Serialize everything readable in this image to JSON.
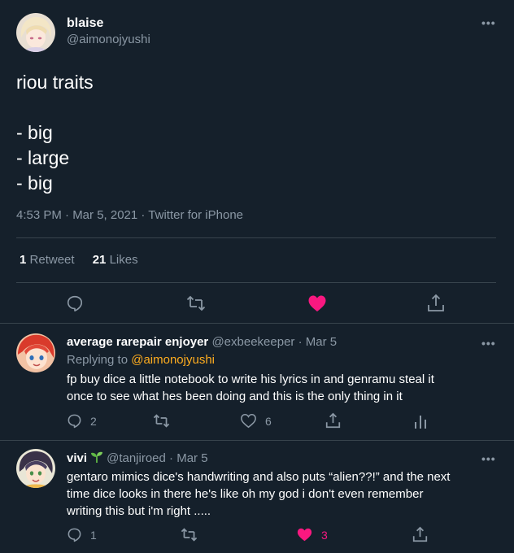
{
  "main_tweet": {
    "display_name": "blaise",
    "handle": "@aimonojyushi",
    "text_lines": [
      "riou traits",
      "",
      "- big",
      "- large",
      "- big"
    ],
    "meta": "4:53 PM · Mar 5, 2021 · Twitter for iPhone",
    "retweets": {
      "count": "1",
      "label": "Retweet"
    },
    "likes": {
      "count": "21",
      "label": "Likes"
    },
    "colors": {
      "like": "#f91880",
      "link": "#ffad1f"
    }
  },
  "replies": [
    {
      "display_name": "average rarepair enjoyer",
      "handle": "@exbeekeeper",
      "date": "· Mar 5",
      "replying_prefix": "Replying to",
      "replying_to": "@aimonojyushi",
      "text_lines": [
        "fp buy dice a little notebook to write his lyrics in and genramu steal it",
        "once to see what hes been doing and this is the only thing in it"
      ],
      "reply_count": "2",
      "retweet_count": "",
      "like_count": "6",
      "liked": false,
      "emoji": ""
    },
    {
      "display_name": "vivi",
      "handle": "@tanjiroed",
      "date": "· Mar 5",
      "emoji": "🌱",
      "text_lines": [
        "gentaro mimics dice's handwriting and also puts “alien??!” and the next",
        "time dice looks in there he's like oh my god i don't even remember",
        "writing this but i'm right ....."
      ],
      "reply_count": "1",
      "retweet_count": "",
      "like_count": "3",
      "liked": true
    }
  ]
}
